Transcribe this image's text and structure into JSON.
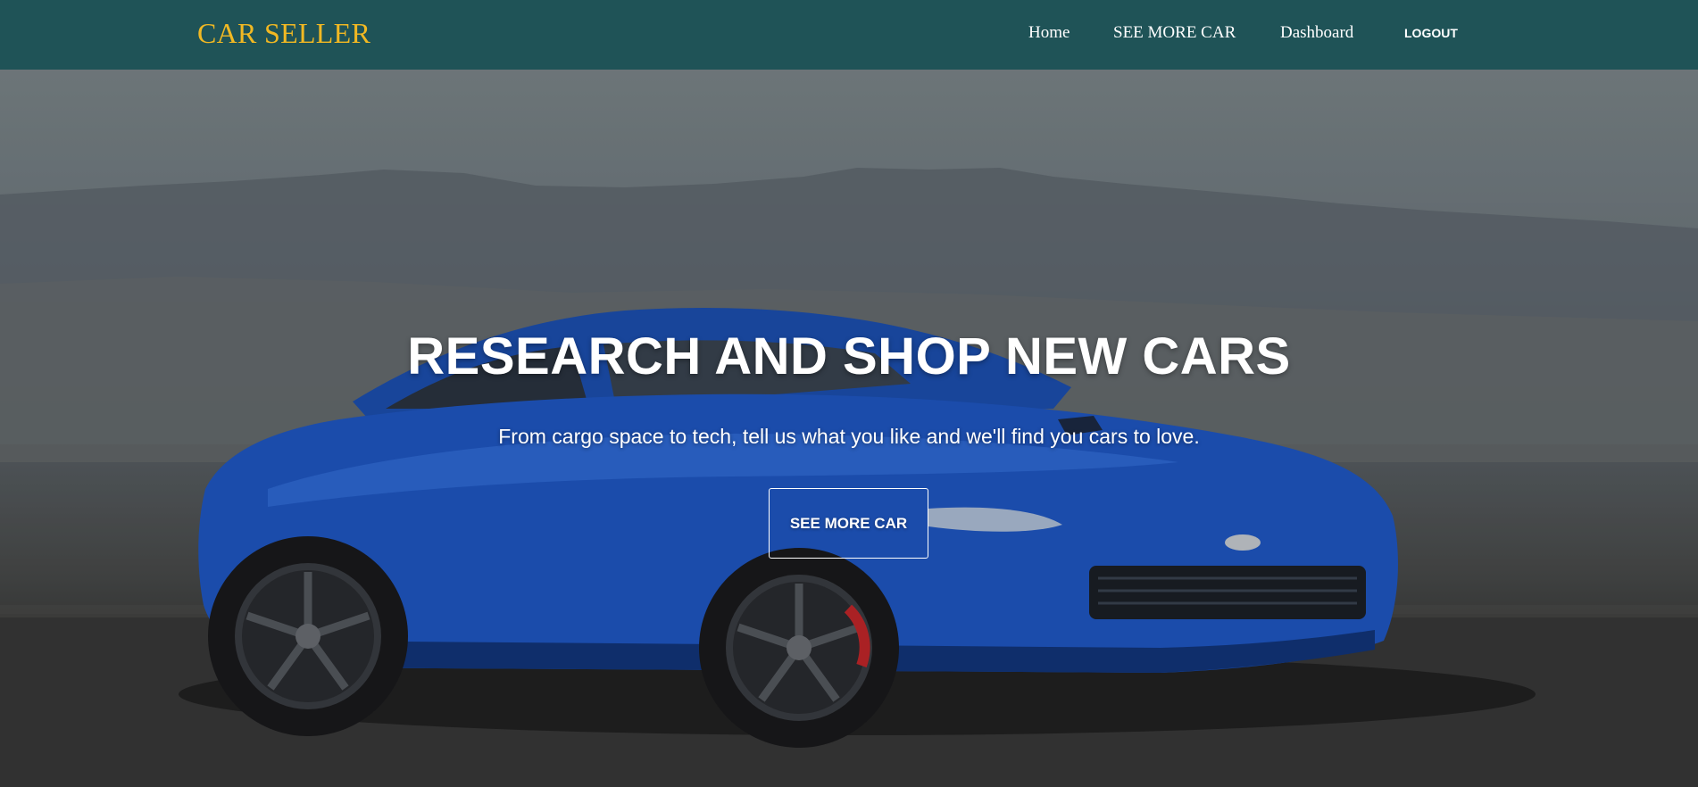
{
  "nav": {
    "brand": "CAR SELLER",
    "links": [
      {
        "label": "Home"
      },
      {
        "label": "SEE MORE CAR"
      },
      {
        "label": "Dashboard"
      }
    ],
    "logout_label": "LOGOUT"
  },
  "hero": {
    "title": "RESEARCH AND SHOP NEW CARS",
    "subtitle": "From cargo space to tech, tell us what you like and we'll find you cars to love.",
    "button_label": "SEE MORE CAR"
  },
  "colors": {
    "navbar_bg": "#1f5357",
    "brand": "#f1b823",
    "car_body": "#1f57c3",
    "text": "#ffffff"
  }
}
